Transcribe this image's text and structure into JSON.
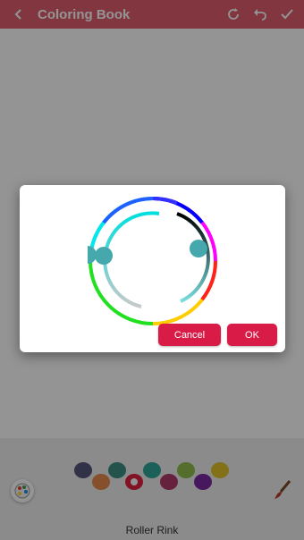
{
  "appbar": {
    "title": "Coloring Book",
    "back_icon": "arrow-left-icon",
    "actions": [
      "refresh-icon",
      "undo-icon",
      "check-icon"
    ]
  },
  "colors": {
    "accent": "#d81b47",
    "appbar": "#e0606f",
    "handle": "#44a8ac"
  },
  "dialog": {
    "cancel_label": "Cancel",
    "ok_label": "OK"
  },
  "palette": {
    "swatches": [
      "#55557a",
      "#e58a4a",
      "#3f8f82",
      "#e02040",
      "#2fa89a",
      "#b03a6a",
      "#8fc04a",
      "#7a2aa0",
      "#e2c32c"
    ]
  },
  "picture": {
    "name": "Roller Rink"
  }
}
